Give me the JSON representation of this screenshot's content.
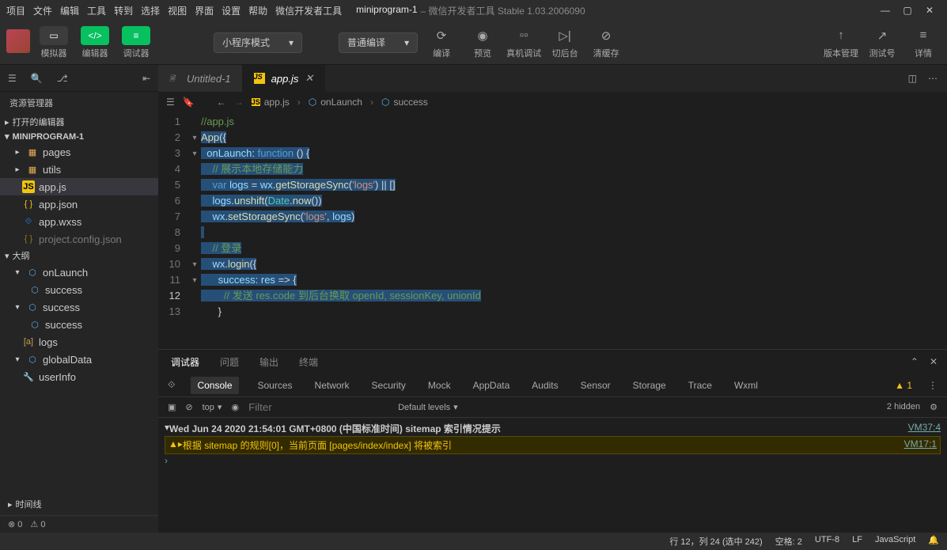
{
  "menu": [
    "项目",
    "文件",
    "编辑",
    "工具",
    "转到",
    "选择",
    "视图",
    "界面",
    "设置",
    "帮助",
    "微信开发者工具"
  ],
  "app_title": {
    "project": "miniprogram-1",
    "rest": " – 微信开发者工具 Stable 1.03.2006090"
  },
  "toolbar": {
    "simulator": "模拟器",
    "editor": "编辑器",
    "debugger": "调试器",
    "mode": "小程序模式",
    "compile_mode": "普通编译",
    "compile": "编译",
    "preview": "预览",
    "real": "真机调试",
    "back": "切后台",
    "cache": "清缓存",
    "version": "版本管理",
    "test": "测试号",
    "detail": "详情"
  },
  "explorer": {
    "title": "资源管理器",
    "sections": {
      "openEditors": "打开的编辑器",
      "project": "MINIPROGRAM-1",
      "outline": "大纲",
      "timeline": "时间线"
    },
    "files": {
      "pages": "pages",
      "utils": "utils",
      "appjs": "app.js",
      "appjson": "app.json",
      "appwxss": "app.wxss",
      "projcfg": "project.config.json"
    },
    "outline": {
      "onLaunch": "onLaunch",
      "success": "success",
      "success2": "success",
      "success3": "success",
      "logs": "logs",
      "globalData": "globalData",
      "userInfo": "userInfo"
    },
    "status": {
      "errors": "0",
      "warnings": "0"
    }
  },
  "tabs": [
    {
      "name": "Untitled-1",
      "icon": "file",
      "active": false
    },
    {
      "name": "app.js",
      "icon": "js",
      "active": true
    }
  ],
  "breadcrumbs": [
    "app.js",
    "onLaunch",
    "success"
  ],
  "code": {
    "lines": [
      {
        "n": 1,
        "h": false,
        "html": "<span class='tk-comment'>//app.js</span>"
      },
      {
        "n": 2,
        "h": true,
        "html": "<span class='tk-fn'>App</span><span class='tk-op'>({</span>"
      },
      {
        "n": 3,
        "h": true,
        "html": "  <span class='tk-prop'>onLaunch</span><span class='tk-op'>: </span><span class='tk-kw'>function</span><span class='tk-op'> () {</span>"
      },
      {
        "n": 4,
        "h": true,
        "html": "    <span class='tk-comment'>// 展示本地存储能力</span>"
      },
      {
        "n": 5,
        "h": true,
        "html": "    <span class='tk-kw'>var</span> <span class='tk-var'>logs</span> <span class='tk-op'>=</span> <span class='tk-var'>wx</span><span class='tk-op'>.</span><span class='tk-fn'>getStorageSync</span><span class='tk-op'>(</span><span class='tk-str'>'logs'</span><span class='tk-op'>) || []</span>"
      },
      {
        "n": 6,
        "h": true,
        "html": "    <span class='tk-var'>logs</span><span class='tk-op'>.</span><span class='tk-fn'>unshift</span><span class='tk-op'>(</span><span class='tk-obj'>Date</span><span class='tk-op'>.</span><span class='tk-fn'>now</span><span class='tk-op'>())</span>"
      },
      {
        "n": 7,
        "h": true,
        "html": "    <span class='tk-var'>wx</span><span class='tk-op'>.</span><span class='tk-fn'>setStorageSync</span><span class='tk-op'>(</span><span class='tk-str'>'logs'</span><span class='tk-op'>, </span><span class='tk-var'>logs</span><span class='tk-op'>)</span>"
      },
      {
        "n": 8,
        "h": true,
        "html": ""
      },
      {
        "n": 9,
        "h": true,
        "html": "    <span class='tk-comment'>// 登录</span>"
      },
      {
        "n": 10,
        "h": true,
        "html": "    <span class='tk-var'>wx</span><span class='tk-op'>.</span><span class='tk-fn'>login</span><span class='tk-op'>({</span>"
      },
      {
        "n": 11,
        "h": true,
        "html": "      <span class='tk-prop'>success</span><span class='tk-op'>: </span><span class='tk-var'>res</span> <span class='tk-op'>=&gt; {</span>"
      },
      {
        "n": 12,
        "h": true,
        "html": "        <span class='tk-comment'>// 发送 res.code 到后台换取 openId, sessionKey, unionId</span>"
      },
      {
        "n": 13,
        "h": false,
        "html": "      <span class='tk-op'>}</span>"
      }
    ]
  },
  "panel": {
    "tabs": [
      "调试器",
      "问题",
      "输出",
      "终端"
    ],
    "devtabs": [
      "Console",
      "Sources",
      "Network",
      "Security",
      "Mock",
      "AppData",
      "Audits",
      "Sensor",
      "Storage",
      "Trace",
      "Wxml"
    ],
    "warn_count": "1",
    "context": "top",
    "filter_ph": "Filter",
    "levels": "Default levels",
    "hidden": "2 hidden",
    "log1": "Wed Jun 24 2020 21:54:01 GMT+0800 (中国标准时间) sitemap 索引情况提示",
    "src1": "VM37:4",
    "log2": "根据 sitemap 的规则[0]，当前页面 [pages/index/index] 将被索引",
    "src2": "VM17:1"
  },
  "status": {
    "pos": "行 12，列 24 (选中 242)",
    "spaces": "空格: 2",
    "enc": "UTF-8",
    "eol": "LF",
    "lang": "JavaScript"
  }
}
